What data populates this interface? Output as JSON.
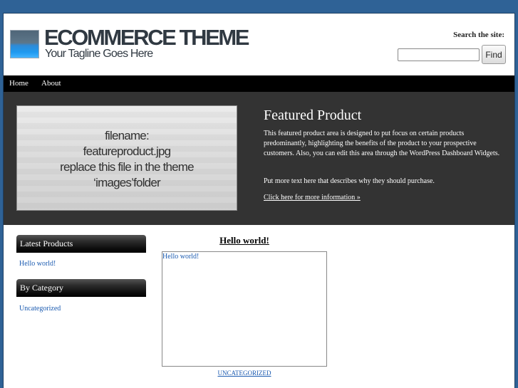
{
  "header": {
    "logo_title": "ECOMMERCE THEME",
    "logo_tagline": "Your Tagline Goes Here",
    "search_label": "Search the site:",
    "search_value": "",
    "find_label": "Find"
  },
  "nav": {
    "items": [
      {
        "label": "Home"
      },
      {
        "label": "About"
      }
    ]
  },
  "featured": {
    "image_text": [
      "filename:",
      "featureproduct.jpg",
      "replace this file in the theme",
      "‘images’folder"
    ],
    "title": "Featured Product",
    "paragraph1": "This featured product area is designed to put focus on certain products predominantly, highlighting the benefits of the product to your prospective customers. Also, you can edit this area through the WordPress Dashboard Widgets.",
    "paragraph2": "Put more text here that describes why they should purchase.",
    "link": "Click here for more information »"
  },
  "sidebar": {
    "latest_title": "Latest Products",
    "latest_items": [
      {
        "label": "Hello world!"
      }
    ],
    "category_title": "By Category",
    "category_items": [
      {
        "label": "Uncategorized"
      }
    ]
  },
  "post": {
    "title": "Hello world!",
    "frame_link": "Hello world!",
    "category": "UNCATEGORIZED"
  },
  "colors": {
    "background": "#2f6296",
    "nav": "#000000",
    "featured_bg": "#333333",
    "link": "#1a5ab0"
  }
}
